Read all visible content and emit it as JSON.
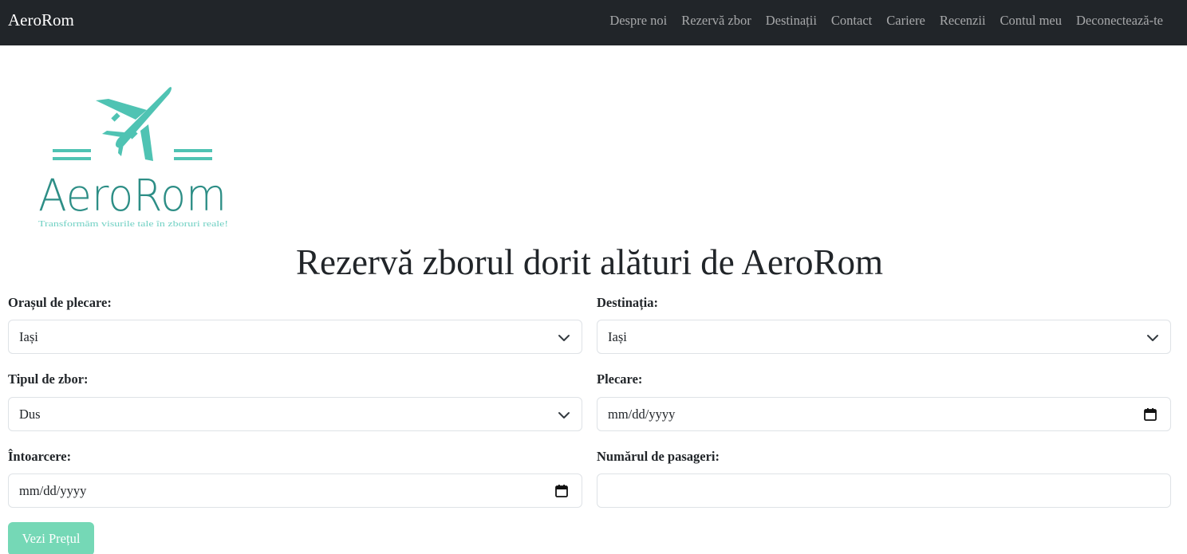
{
  "navbar": {
    "brand": "AeroRom",
    "links": [
      "Despre noi",
      "Rezervă zbor",
      "Destinații",
      "Contact",
      "Cariere",
      "Recenzii",
      "Contul meu",
      "Deconectează-te"
    ]
  },
  "logo": {
    "name": "AeroRom",
    "tagline": "Transformăm visurile tale în zboruri reale!",
    "color": "#4fc3b3"
  },
  "page": {
    "title": "Rezervă zborul dorit alături de AeroRom"
  },
  "form": {
    "origin": {
      "label": "Orașul de plecare:",
      "value": "Iași"
    },
    "destination": {
      "label": "Destinația:",
      "value": "Iași"
    },
    "flight_type": {
      "label": "Tipul de zbor:",
      "value": "Dus"
    },
    "departure": {
      "label": "Plecare:",
      "placeholder": "mm/dd/yyyy"
    },
    "return": {
      "label": "Întoarcere:",
      "placeholder": "mm/dd/yyyy"
    },
    "passengers": {
      "label": "Numărul de pasageri:",
      "value": ""
    },
    "submit_label": "Vezi Prețul"
  },
  "colors": {
    "navbar_bg": "#212529",
    "accent": "#75d8b6",
    "logo": "#4fc3b3"
  }
}
